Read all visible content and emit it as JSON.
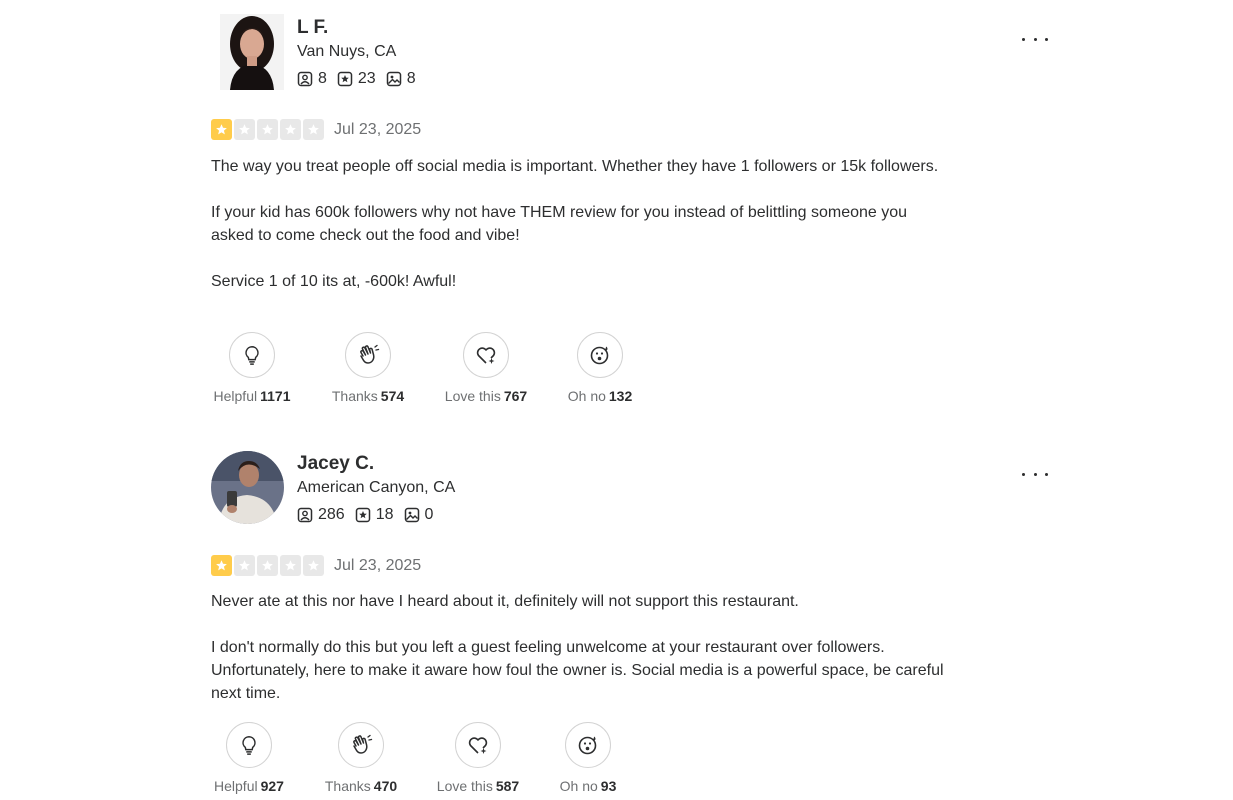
{
  "reviews": [
    {
      "name": "L F.",
      "location": "Van Nuys, CA",
      "friends": "8",
      "reviews": "23",
      "photos": "8",
      "rating": 1,
      "date": "Jul 23, 2025",
      "paragraphs": [
        "The way you treat people off social media is important. Whether they have 1 followers or 15k followers.",
        "If your kid has 600k followers why not have THEM review for you instead of belittling someone you asked to come check out the food and vibe!",
        "Service 1 of 10 its at, -600k! Awful!"
      ],
      "reactions": [
        {
          "label": "Helpful",
          "count": "1171",
          "icon": "lightbulb-icon"
        },
        {
          "label": "Thanks",
          "count": "574",
          "icon": "waving-hand-icon"
        },
        {
          "label": "Love this",
          "count": "767",
          "icon": "heart-sparkle-icon"
        },
        {
          "label": "Oh no",
          "count": "132",
          "icon": "shocked-face-icon"
        }
      ]
    },
    {
      "name": "Jacey C.",
      "location": "American Canyon, CA",
      "friends": "286",
      "reviews": "18",
      "photos": "0",
      "rating": 1,
      "date": "Jul 23, 2025",
      "paragraphs": [
        "Never ate at this nor have I heard about it, definitely will not support this restaurant.",
        "I don't normally do this but you left a guest feeling unwelcome at your restaurant over followers. Unfortunately, here to make it aware how foul the owner is. Social media is a powerful space, be careful next time."
      ],
      "reactions": [
        {
          "label": "Helpful",
          "count": "927",
          "icon": "lightbulb-icon"
        },
        {
          "label": "Thanks",
          "count": "470",
          "icon": "waving-hand-icon"
        },
        {
          "label": "Love this",
          "count": "587",
          "icon": "heart-sparkle-icon"
        },
        {
          "label": "Oh no",
          "count": "93",
          "icon": "shocked-face-icon"
        }
      ]
    }
  ],
  "colors": {
    "star_on": "#ffcc4b",
    "star_off": "#e8e8e8",
    "text": "#2d2e2f",
    "muted": "#6e7072"
  }
}
